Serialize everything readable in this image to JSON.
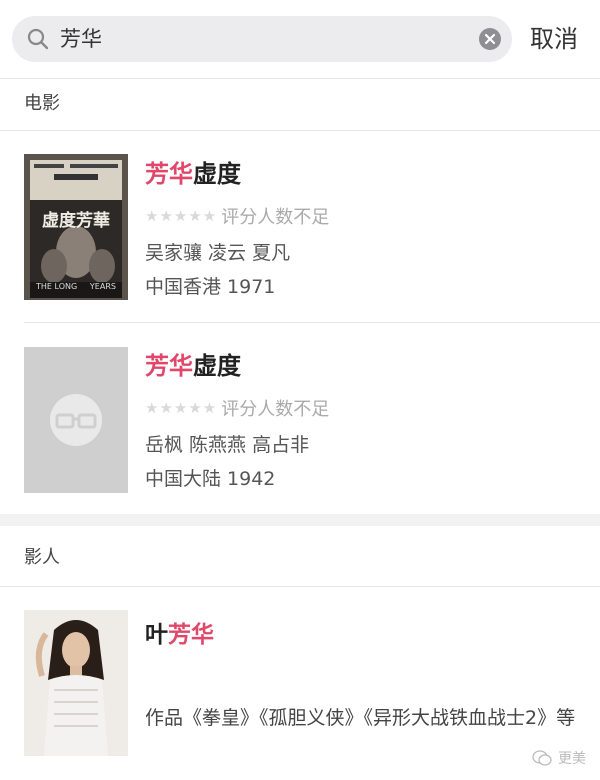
{
  "search": {
    "query": "芳华",
    "cancel_label": "取消"
  },
  "sections": {
    "movies_header": "电影",
    "people_header": "影人"
  },
  "movies": [
    {
      "title_highlight": "芳华",
      "title_rest": "虚度",
      "stars": "★★★★★",
      "rating_text": "评分人数不足",
      "cast": "吴家骧 凌云 夏凡",
      "region_year": "中国香港 1971",
      "poster_text": "虚度芳華",
      "poster_tagline": "THE LONG     YEARS"
    },
    {
      "title_highlight": "芳华",
      "title_rest": "虚度",
      "stars": "★★★★★",
      "rating_text": "评分人数不足",
      "cast": "岳枫 陈燕燕 高占非",
      "region_year": "中国大陆 1942"
    }
  ],
  "people": [
    {
      "name_prefix": "叶",
      "name_highlight": "芳华",
      "works": "作品《拳皇》《孤胆义侠》《异形大战铁血战士2》等"
    }
  ],
  "watermark": {
    "text": "更美"
  },
  "colors": {
    "highlight": "#e0476b",
    "search_bg": "#ececef",
    "star_empty": "#d9d9d9"
  }
}
